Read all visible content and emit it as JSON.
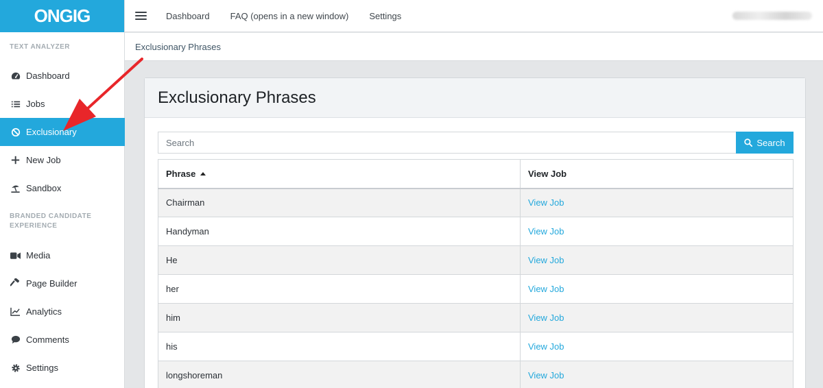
{
  "brand": {
    "logo": "ONGIG",
    "accent": "#23a8dc"
  },
  "topbar": {
    "menu_icon": "hamburger-icon",
    "links": [
      "Dashboard",
      "FAQ (opens in a new window)",
      "Settings"
    ]
  },
  "sidebar": {
    "section1": "TEXT ANALYZER",
    "section2": "BRANDED CANDIDATE EXPERIENCE",
    "items": [
      {
        "label": "Dashboard",
        "icon": "speedometer-icon"
      },
      {
        "label": "Jobs",
        "icon": "list-icon"
      },
      {
        "label": "Exclusionary",
        "icon": "ban-icon",
        "active": true
      },
      {
        "label": "New Job",
        "icon": "plus-icon"
      },
      {
        "label": "Sandbox",
        "icon": "umbrella-beach-icon"
      },
      {
        "label": "Media",
        "icon": "video-icon"
      },
      {
        "label": "Page Builder",
        "icon": "hammer-icon"
      },
      {
        "label": "Analytics",
        "icon": "chart-line-icon"
      },
      {
        "label": "Comments",
        "icon": "comment-icon"
      },
      {
        "label": "Settings",
        "icon": "gear-icon"
      }
    ]
  },
  "breadcrumb": "Exclusionary Phrases",
  "main": {
    "title": "Exclusionary Phrases",
    "search": {
      "placeholder": "Search",
      "button": "Search"
    },
    "table": {
      "headers": [
        "Phrase",
        "View Job"
      ],
      "rows": [
        [
          "Chairman",
          "View Job"
        ],
        [
          "Handyman",
          "View Job"
        ],
        [
          "He",
          "View Job"
        ],
        [
          "her",
          "View Job"
        ],
        [
          "him",
          "View Job"
        ],
        [
          "his",
          "View Job"
        ],
        [
          "longshoreman",
          "View Job"
        ]
      ]
    }
  }
}
